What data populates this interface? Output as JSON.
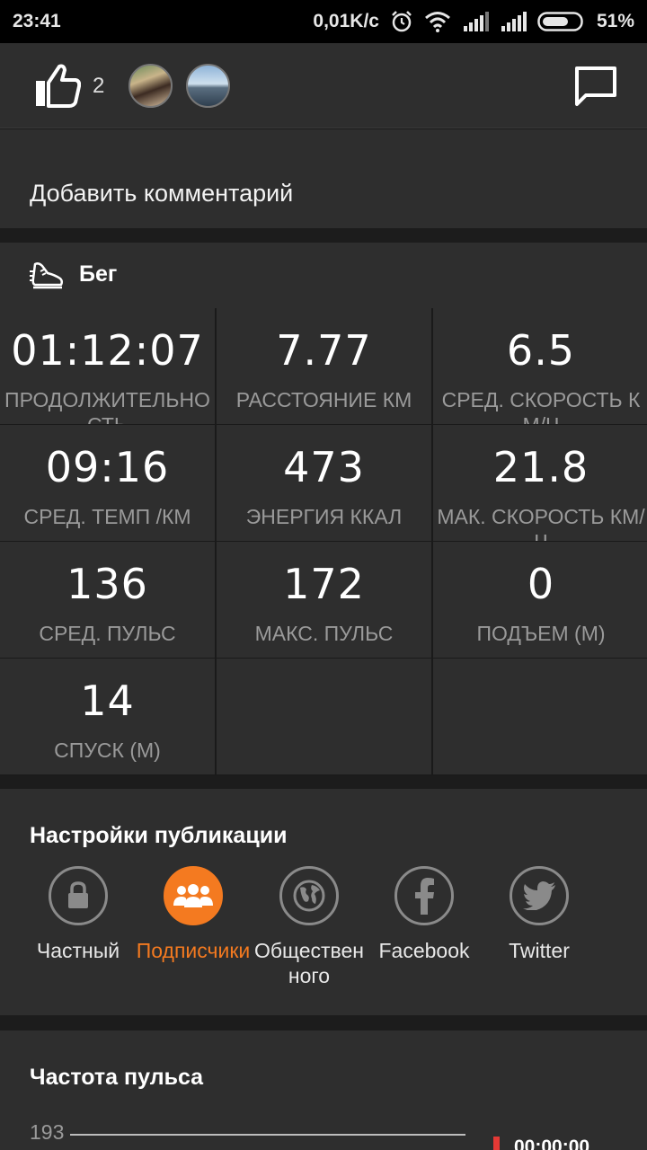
{
  "status_bar": {
    "time": "23:41",
    "network_speed": "0,01K/c",
    "battery": "51%",
    "icons": [
      "alarm-icon",
      "wifi-icon",
      "signal-icon",
      "signal-icon",
      "battery-icon"
    ]
  },
  "social": {
    "like_count": "2",
    "avatars": [
      "avatar-1",
      "avatar-2"
    ]
  },
  "comment": {
    "placeholder": "Добавить комментарий"
  },
  "activity": {
    "title": "Бег"
  },
  "stats": [
    {
      "value": "01:12:07",
      "label": "ПРОДОЛЖИТЕЛЬНОСТЬ"
    },
    {
      "value": "7.77",
      "label": "РАССТОЯНИЕ КМ"
    },
    {
      "value": "6.5",
      "label": "СРЕД. СКОРОСТЬ КМ/Ч"
    },
    {
      "value": "09:16",
      "label": "СРЕД. ТЕМП /КМ"
    },
    {
      "value": "473",
      "label": "ЭНЕРГИЯ ККАЛ"
    },
    {
      "value": "21.8",
      "label": "МАК. СКОРОСТЬ КМ/Ч"
    },
    {
      "value": "136",
      "label": "СРЕД. ПУЛЬС"
    },
    {
      "value": "172",
      "label": "МАКС. ПУЛЬС"
    },
    {
      "value": "0",
      "label": "ПОДЪЕМ (М)"
    },
    {
      "value": "14",
      "label": "СПУСК (М)"
    }
  ],
  "publish": {
    "title": "Настройки публикации",
    "options": [
      {
        "label": "Частный",
        "icon": "lock-icon",
        "selected": false
      },
      {
        "label": "Подписчики",
        "icon": "people-icon",
        "selected": true
      },
      {
        "label": "Общественного",
        "icon": "globe-icon",
        "selected": false
      },
      {
        "label": "Facebook",
        "icon": "facebook-icon",
        "selected": false
      },
      {
        "label": "Twitter",
        "icon": "twitter-icon",
        "selected": false
      }
    ],
    "accent_color": "#f47a20"
  },
  "heart_rate": {
    "title": "Частота пульса",
    "y_tick": "193",
    "current_time": "00:00:00",
    "marker_color": "#e53935"
  }
}
